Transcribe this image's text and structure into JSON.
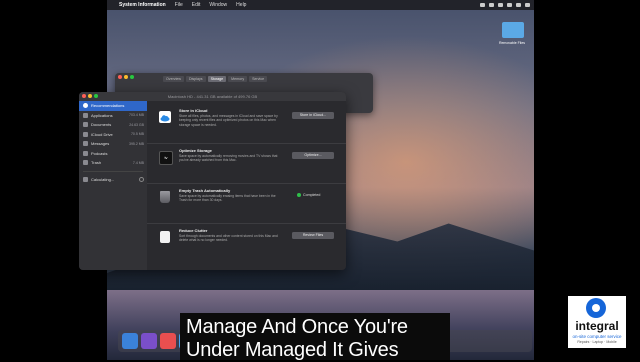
{
  "menubar": {
    "app_name": "System Information",
    "items": [
      "File",
      "Edit",
      "Window",
      "Help"
    ]
  },
  "desktop": {
    "folder_label": "Removable Files"
  },
  "back_window": {
    "tabs": [
      "Overview",
      "Displays",
      "Storage",
      "Memory",
      "Service"
    ],
    "selected_tab": "Storage",
    "storage_line": "Macintosh HD - 441.31 GB available of 499.76 GB"
  },
  "window": {
    "title": "Macintosh HD - 441.31 GB available of 499.76 GB",
    "sidebar": {
      "items": [
        {
          "label": "Recommendations",
          "size": "",
          "selected": true
        },
        {
          "label": "Applications",
          "size": "703.4 MB"
        },
        {
          "label": "Documents",
          "size": "24.63 GB"
        },
        {
          "label": "iCloud Drive",
          "size": "70.5 MB"
        },
        {
          "label": "Messages",
          "size": "395.2 MB"
        },
        {
          "label": "Podcasts",
          "size": ""
        },
        {
          "label": "Trash",
          "size": "7.4 MB"
        }
      ],
      "calculating": "Calculating..."
    },
    "recommendations": [
      {
        "title": "Store in iCloud",
        "desc": "Store all files, photos, and messages in iCloud and save space by keeping only recent files and optimized photos on this Mac when storage space is needed.",
        "button": "Store in iCloud...",
        "icon": "cloud-icon"
      },
      {
        "title": "Optimize Storage",
        "desc": "Save space by automatically removing movies and TV shows that you've already watched from this Mac.",
        "button": "Optimize...",
        "icon": "apple-tv-icon"
      },
      {
        "title": "Empty Trash Automatically",
        "desc": "Save space by automatically erasing items that have been in the Trash for more than 30 days.",
        "status": "Completed",
        "icon": "trash-icon"
      },
      {
        "title": "Reduce Clutter",
        "desc": "Sort through documents and other content stored on this Mac and delete what is no longer needed.",
        "button": "Review Files",
        "icon": "document-icon"
      }
    ]
  },
  "caption": {
    "line1": "Manage And Once You're",
    "line2": "Under Managed It Gives"
  },
  "logo": {
    "name": "integral",
    "tagline": "on-site computer service",
    "sub": "Repairs · Laptop · Mobile"
  },
  "colors": {
    "accent": "#2f67c9",
    "completed": "#2fbf4a",
    "logo_blue": "#1565d8"
  }
}
